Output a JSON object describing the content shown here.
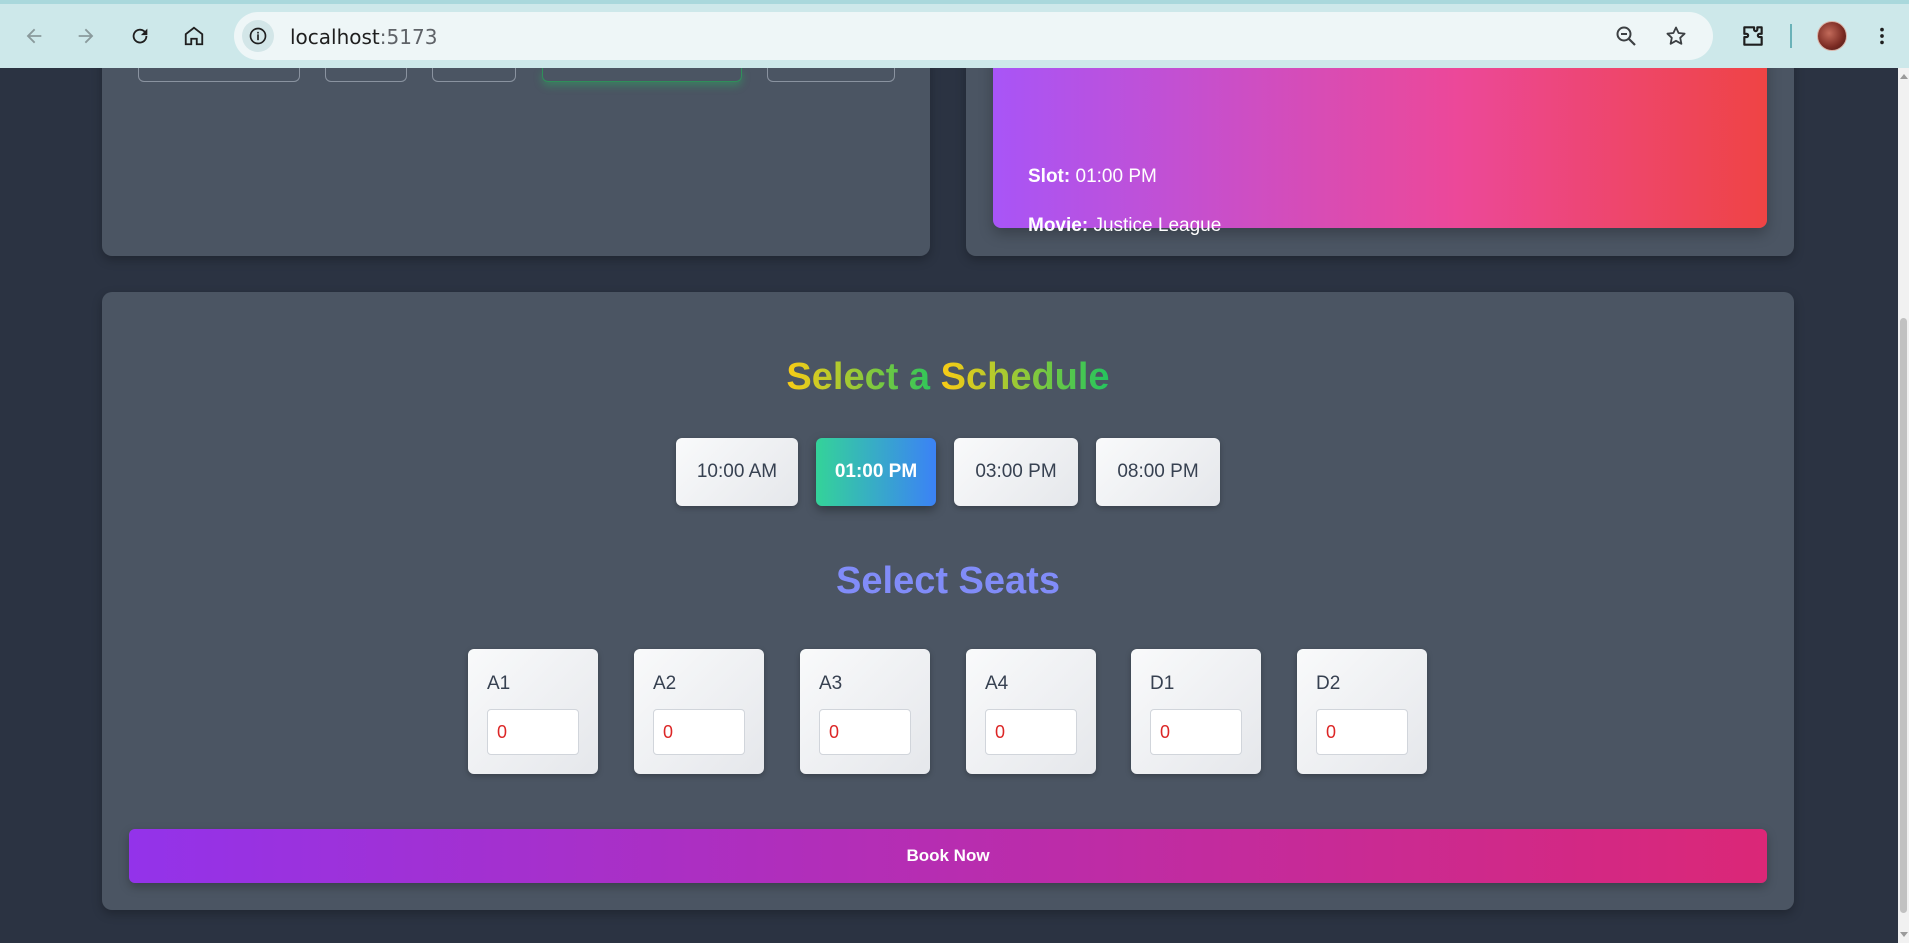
{
  "browser": {
    "url_host": "localhost",
    "url_port": ":5173"
  },
  "summary": {
    "slot_label": "Slot:",
    "slot_value": " 01:00 PM",
    "movie_label": "Movie:",
    "movie_value": " Justice League"
  },
  "schedule": {
    "title_part1": "Select a ",
    "title_part2": "Schedule",
    "slots": [
      "10:00 AM",
      "01:00 PM",
      "03:00 PM",
      "08:00 PM"
    ],
    "selected": "01:00 PM"
  },
  "seats": {
    "title": "Select Seats",
    "items": [
      {
        "label": "A1",
        "value": "0"
      },
      {
        "label": "A2",
        "value": "0"
      },
      {
        "label": "A3",
        "value": "0"
      },
      {
        "label": "A4",
        "value": "0"
      },
      {
        "label": "D1",
        "value": "0"
      },
      {
        "label": "D2",
        "value": "0"
      }
    ]
  },
  "book_button": "Book Now",
  "colors": {
    "page_bg": "#2b3342",
    "card_bg": "#4b5563",
    "active_slot_start": "#34d399",
    "active_slot_end": "#3b82f6",
    "book_start": "#9333ea",
    "book_end": "#db2777",
    "seats_title": "#818cf8"
  }
}
